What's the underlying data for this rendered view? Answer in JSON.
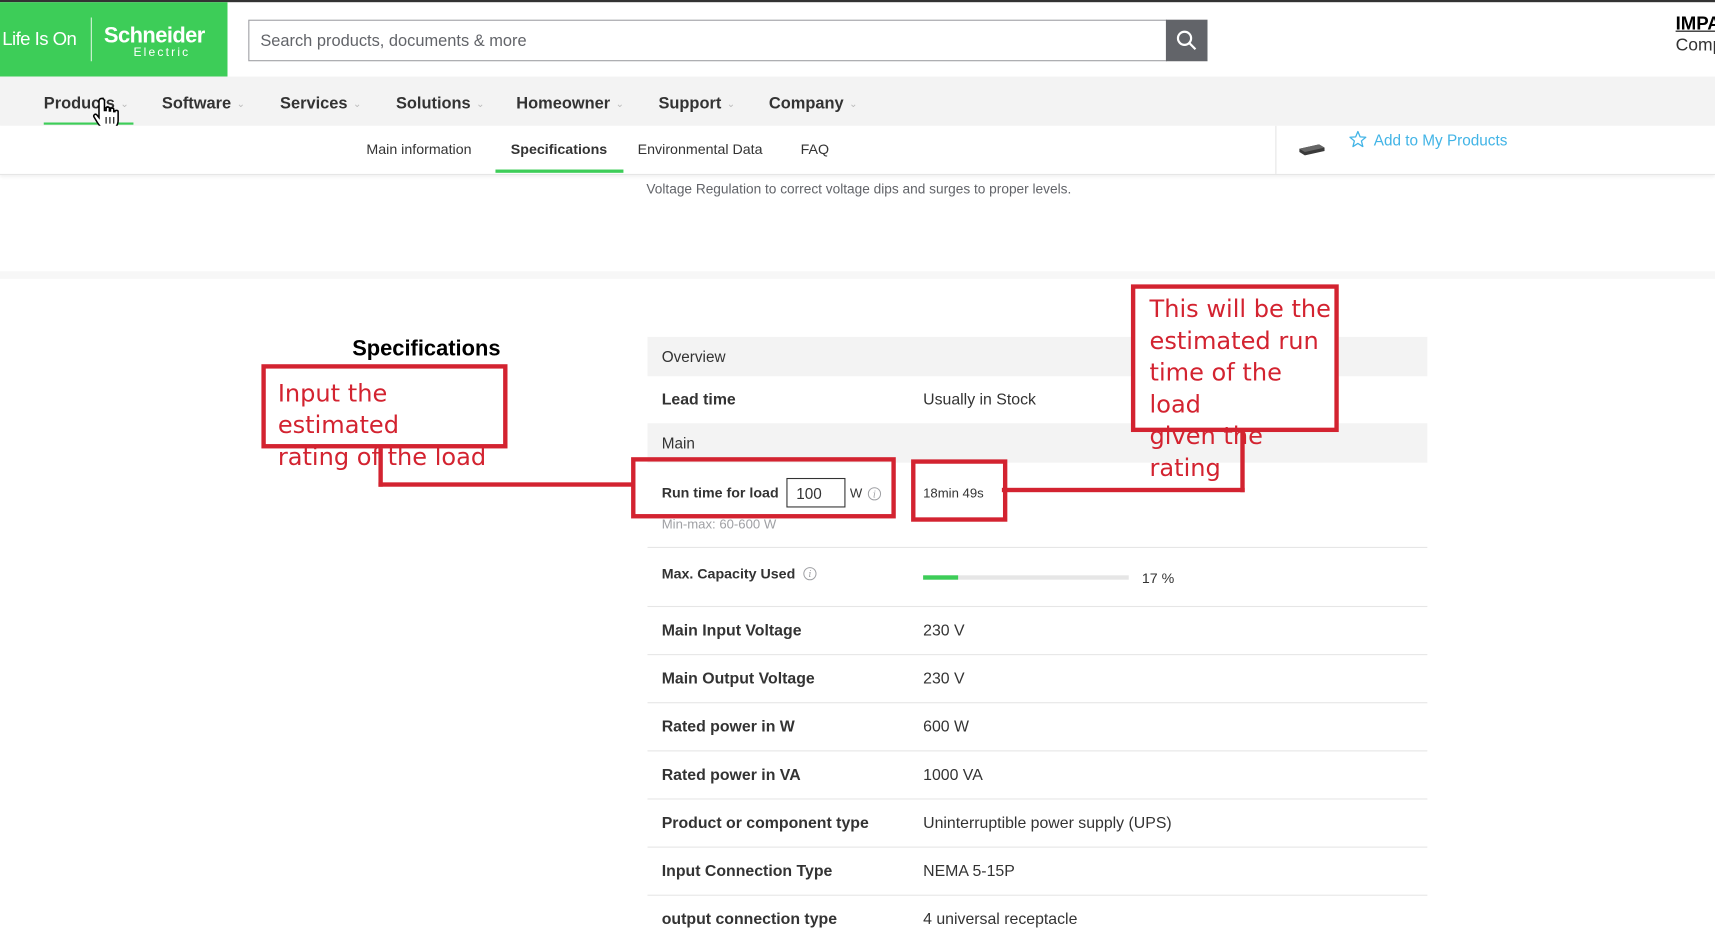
{
  "brand": {
    "tagline": "Life Is On",
    "name": "Schneider",
    "sub": "Electric"
  },
  "search": {
    "placeholder": "Search products, documents & more"
  },
  "account": {
    "line1": "IMPA",
    "line2": "Comp"
  },
  "main_nav": [
    "Products",
    "Software",
    "Services",
    "Solutions",
    "Homeowner",
    "Support",
    "Company"
  ],
  "sub_nav": {
    "tabs": [
      "Main information",
      "Specifications",
      "Environmental Data",
      "FAQ"
    ],
    "active": "Specifications",
    "add_to_my_products": "Add to My Products"
  },
  "description": "Voltage Regulation to correct voltage dips and surges to proper levels.",
  "specs": {
    "heading": "Specifications",
    "overview_label": "Overview",
    "lead_time": {
      "key": "Lead time",
      "value": "Usually in Stock"
    },
    "main_label": "Main",
    "runtime": {
      "label": "Run time for load",
      "input_value": "100",
      "unit": "W",
      "minmax": "Min-max: 60-600 W",
      "result": "18min 49s"
    },
    "capacity": {
      "label": "Max. Capacity Used",
      "percent": 17,
      "percent_text": "17 %"
    },
    "rows": [
      {
        "key": "Main Input Voltage",
        "value": "230 V"
      },
      {
        "key": "Main Output Voltage",
        "value": "230 V"
      },
      {
        "key": "Rated power in W",
        "value": "600 W"
      },
      {
        "key": "Rated power in VA",
        "value": "1000 VA"
      },
      {
        "key": "Product or component type",
        "value": "Uninterruptible power supply (UPS)"
      },
      {
        "key": "Input Connection Type",
        "value": "NEMA 5-15P"
      },
      {
        "key": "output connection type",
        "value": "4 universal receptacle"
      }
    ]
  },
  "annotations": {
    "left": {
      "line1": "Input the estimated",
      "line2": "rating of the load"
    },
    "right": {
      "line1": "This will be the",
      "line2": "estimated run",
      "line3": "time of the load",
      "line4": "given the rating"
    }
  },
  "colors": {
    "brand_green": "#3dcd58",
    "annotation_red": "#d32330",
    "link_blue": "#42b4e6"
  }
}
